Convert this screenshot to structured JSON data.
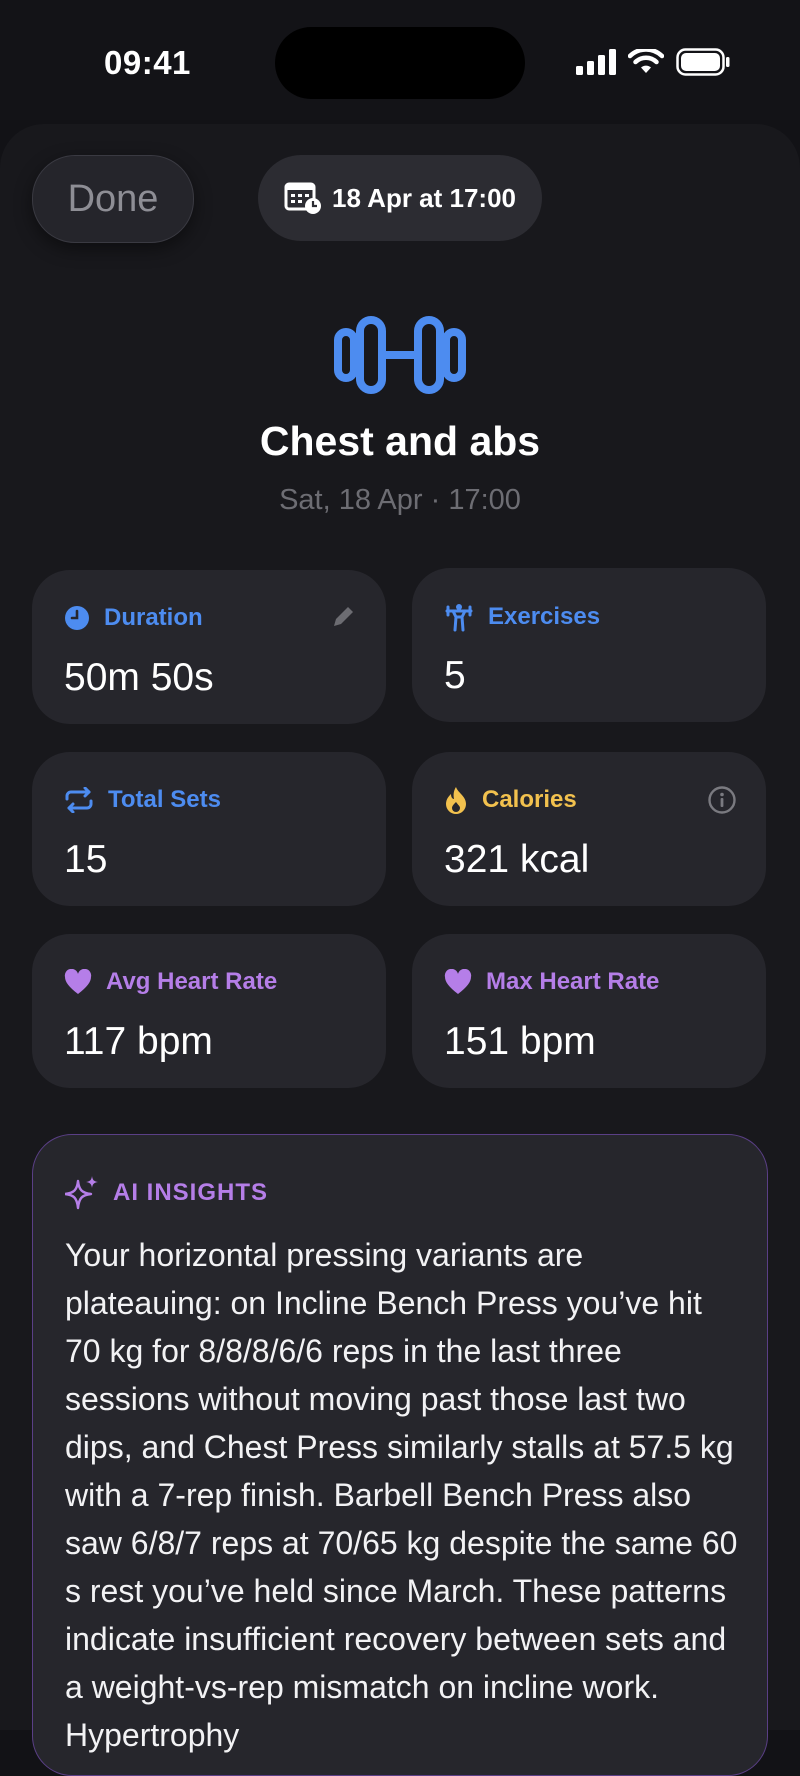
{
  "status": {
    "time": "09:41"
  },
  "header": {
    "done_label": "Done",
    "date_label": "18 Apr at 17:00"
  },
  "workout": {
    "title": "Chest and abs",
    "subtitle": "Sat, 18 Apr · 17:00",
    "icon": "dumbbell-icon"
  },
  "stats": [
    {
      "label": "Duration",
      "value": "50m 50s",
      "icon": "clock-icon",
      "accent": "#4d8cf0"
    },
    {
      "label": "Exercises",
      "value": "5",
      "icon": "weightlifter-icon",
      "accent": "#4d8cf0"
    },
    {
      "label": "Total Sets",
      "value": "15",
      "icon": "repeat-icon",
      "accent": "#4d8cf0"
    },
    {
      "label": "Calories",
      "value": "321 kcal",
      "icon": "flame-icon",
      "accent": "#f2c14e"
    },
    {
      "label": "Avg Heart Rate",
      "value": "117 bpm",
      "icon": "heart-icon",
      "accent": "#b57ee8"
    },
    {
      "label": "Max Heart Rate",
      "value": "151 bpm",
      "icon": "heart-icon",
      "accent": "#b57ee8"
    }
  ],
  "insights": {
    "title": "AI INSIGHTS",
    "text": "Your horizontal pressing variants are plateauing: on Incline Bench Press you’ve hit 70 kg for 8/8/8/6/6 reps in the last three sessions without moving past those last two dips, and Chest Press similarly stalls at 57.5 kg with a 7-rep finish. Barbell Bench Press also saw 6/8/7 reps at 70/65 kg despite the same 60 s rest you’ve held since March. These patterns indicate insufficient recovery between sets and a weight-vs-rep mismatch on incline work. Hypertrophy"
  }
}
